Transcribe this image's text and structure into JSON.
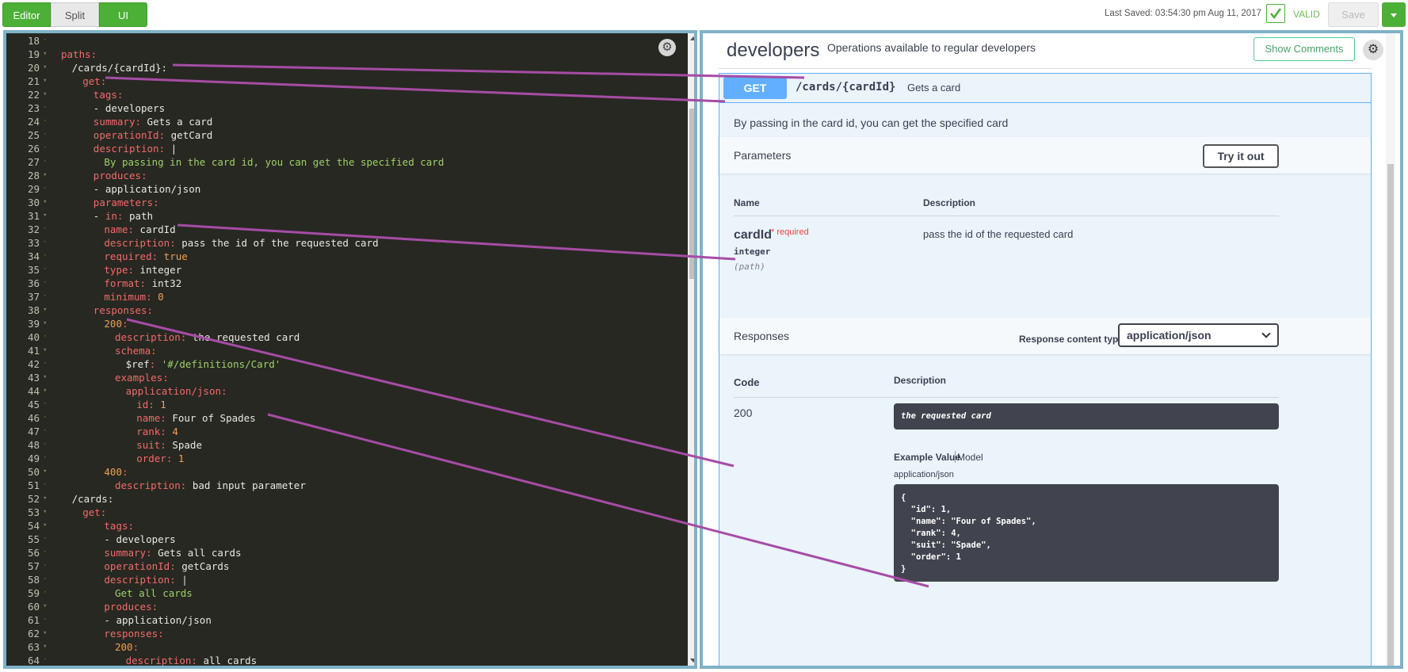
{
  "topbar": {
    "editor_label": "Editor",
    "split_label": "Split",
    "ui_label": "UI",
    "last_saved": "Last Saved: 03:54:30 pm Aug 11, 2017",
    "valid_label": "VALID",
    "save_label": "Save"
  },
  "editor": {
    "lines": [
      {
        "n": "18",
        "i": 0,
        "p": []
      },
      {
        "n": "19",
        "i": 0,
        "f": true,
        "p": [
          [
            "k",
            "paths"
          ],
          [
            "k",
            ":"
          ]
        ]
      },
      {
        "n": "20",
        "i": 1,
        "f": true,
        "p": [
          [
            "v",
            "/cards/{cardId}"
          ],
          [
            "v",
            ":"
          ]
        ]
      },
      {
        "n": "21",
        "i": 2,
        "f": true,
        "p": [
          [
            "k",
            "get"
          ],
          [
            "k",
            ":"
          ]
        ]
      },
      {
        "n": "22",
        "i": 3,
        "f": true,
        "p": [
          [
            "k",
            "tags"
          ],
          [
            "k",
            ":"
          ]
        ]
      },
      {
        "n": "23",
        "i": 3,
        "p": [
          [
            "v",
            "- developers"
          ]
        ]
      },
      {
        "n": "24",
        "i": 3,
        "p": [
          [
            "k",
            "summary"
          ],
          [
            "k",
            ":"
          ],
          [
            "v",
            " Gets a card"
          ]
        ]
      },
      {
        "n": "25",
        "i": 3,
        "p": [
          [
            "k",
            "operationId"
          ],
          [
            "k",
            ":"
          ],
          [
            "v",
            " getCard"
          ]
        ]
      },
      {
        "n": "26",
        "i": 3,
        "p": [
          [
            "k",
            "description"
          ],
          [
            "k",
            ":"
          ],
          [
            "v",
            " |"
          ]
        ]
      },
      {
        "n": "27",
        "i": 4,
        "p": [
          [
            "s",
            "By passing in the card id, you can get the specified card"
          ]
        ]
      },
      {
        "n": "28",
        "i": 3,
        "f": true,
        "p": [
          [
            "k",
            "produces"
          ],
          [
            "k",
            ":"
          ]
        ]
      },
      {
        "n": "29",
        "i": 3,
        "p": [
          [
            "v",
            "- application/json"
          ]
        ]
      },
      {
        "n": "30",
        "i": 3,
        "f": true,
        "p": [
          [
            "k",
            "parameters"
          ],
          [
            "k",
            ":"
          ]
        ]
      },
      {
        "n": "31",
        "i": 3,
        "f": true,
        "p": [
          [
            "v",
            "- "
          ],
          [
            "k",
            "in"
          ],
          [
            "k",
            ":"
          ],
          [
            "v",
            " path"
          ]
        ]
      },
      {
        "n": "32",
        "i": 4,
        "p": [
          [
            "k",
            "name"
          ],
          [
            "k",
            ":"
          ],
          [
            "v",
            " cardId"
          ]
        ]
      },
      {
        "n": "33",
        "i": 4,
        "p": [
          [
            "k",
            "description"
          ],
          [
            "k",
            ":"
          ],
          [
            "v",
            " pass the id of the requested card"
          ]
        ]
      },
      {
        "n": "34",
        "i": 4,
        "p": [
          [
            "k",
            "required"
          ],
          [
            "k",
            ":"
          ],
          [
            "n",
            " true"
          ]
        ]
      },
      {
        "n": "35",
        "i": 4,
        "p": [
          [
            "k",
            "type"
          ],
          [
            "k",
            ":"
          ],
          [
            "v",
            " integer"
          ]
        ]
      },
      {
        "n": "36",
        "i": 4,
        "p": [
          [
            "k",
            "format"
          ],
          [
            "k",
            ":"
          ],
          [
            "v",
            " int32"
          ]
        ]
      },
      {
        "n": "37",
        "i": 4,
        "p": [
          [
            "k",
            "minimum"
          ],
          [
            "k",
            ":"
          ],
          [
            "n",
            " 0"
          ]
        ]
      },
      {
        "n": "38",
        "i": 3,
        "f": true,
        "p": [
          [
            "k",
            "responses"
          ],
          [
            "k",
            ":"
          ]
        ]
      },
      {
        "n": "39",
        "i": 4,
        "f": true,
        "p": [
          [
            "n",
            "200"
          ],
          [
            "k",
            ":"
          ]
        ]
      },
      {
        "n": "40",
        "i": 5,
        "p": [
          [
            "k",
            "description"
          ],
          [
            "k",
            ":"
          ],
          [
            "v",
            " the requested card"
          ]
        ]
      },
      {
        "n": "41",
        "i": 5,
        "f": true,
        "p": [
          [
            "k",
            "schema"
          ],
          [
            "k",
            ":"
          ]
        ]
      },
      {
        "n": "42",
        "i": 6,
        "p": [
          [
            "v",
            "$ref"
          ],
          [
            "k",
            ":"
          ],
          [
            "s",
            " '#/definitions/Card'"
          ]
        ]
      },
      {
        "n": "43",
        "i": 5,
        "f": true,
        "p": [
          [
            "k",
            "examples"
          ],
          [
            "k",
            ":"
          ]
        ]
      },
      {
        "n": "44",
        "i": 6,
        "f": true,
        "p": [
          [
            "k",
            "application/json"
          ],
          [
            "k",
            ":"
          ]
        ]
      },
      {
        "n": "45",
        "i": 7,
        "p": [
          [
            "k",
            "id"
          ],
          [
            "k",
            ":"
          ],
          [
            "n",
            " 1"
          ]
        ]
      },
      {
        "n": "46",
        "i": 7,
        "p": [
          [
            "k",
            "name"
          ],
          [
            "k",
            ":"
          ],
          [
            "v",
            " Four of Spades"
          ]
        ]
      },
      {
        "n": "47",
        "i": 7,
        "p": [
          [
            "k",
            "rank"
          ],
          [
            "k",
            ":"
          ],
          [
            "n",
            " 4"
          ]
        ]
      },
      {
        "n": "48",
        "i": 7,
        "p": [
          [
            "k",
            "suit"
          ],
          [
            "k",
            ":"
          ],
          [
            "v",
            " Spade"
          ]
        ]
      },
      {
        "n": "49",
        "i": 7,
        "p": [
          [
            "k",
            "order"
          ],
          [
            "k",
            ":"
          ],
          [
            "n",
            " 1"
          ]
        ]
      },
      {
        "n": "50",
        "i": 4,
        "f": true,
        "p": [
          [
            "n",
            "400"
          ],
          [
            "k",
            ":"
          ]
        ]
      },
      {
        "n": "51",
        "i": 5,
        "p": [
          [
            "k",
            "description"
          ],
          [
            "k",
            ":"
          ],
          [
            "v",
            " bad input parameter"
          ]
        ]
      },
      {
        "n": "52",
        "i": 1,
        "f": true,
        "p": [
          [
            "v",
            "/cards"
          ],
          [
            "v",
            ":"
          ]
        ]
      },
      {
        "n": "53",
        "i": 2,
        "f": true,
        "p": [
          [
            "k",
            "get"
          ],
          [
            "k",
            ":"
          ]
        ]
      },
      {
        "n": "54",
        "i": 4,
        "f": true,
        "p": [
          [
            "k",
            "tags"
          ],
          [
            "k",
            ":"
          ]
        ]
      },
      {
        "n": "55",
        "i": 4,
        "p": [
          [
            "v",
            "- developers"
          ]
        ]
      },
      {
        "n": "56",
        "i": 4,
        "p": [
          [
            "k",
            "summary"
          ],
          [
            "k",
            ":"
          ],
          [
            "v",
            " Gets all cards"
          ]
        ]
      },
      {
        "n": "57",
        "i": 4,
        "p": [
          [
            "k",
            "operationId"
          ],
          [
            "k",
            ":"
          ],
          [
            "v",
            " getCards"
          ]
        ]
      },
      {
        "n": "58",
        "i": 4,
        "p": [
          [
            "k",
            "description"
          ],
          [
            "k",
            ":"
          ],
          [
            "v",
            " |"
          ]
        ]
      },
      {
        "n": "59",
        "i": 5,
        "p": [
          [
            "s",
            "Get all cards"
          ]
        ]
      },
      {
        "n": "60",
        "i": 4,
        "f": true,
        "p": [
          [
            "k",
            "produces"
          ],
          [
            "k",
            ":"
          ]
        ]
      },
      {
        "n": "61",
        "i": 4,
        "p": [
          [
            "v",
            "- application/json"
          ]
        ]
      },
      {
        "n": "62",
        "i": 4,
        "f": true,
        "p": [
          [
            "k",
            "responses"
          ],
          [
            "k",
            ":"
          ]
        ]
      },
      {
        "n": "63",
        "i": 5,
        "f": true,
        "p": [
          [
            "n",
            "200"
          ],
          [
            "k",
            ":"
          ]
        ]
      },
      {
        "n": "64",
        "i": 6,
        "p": [
          [
            "k",
            "description"
          ],
          [
            "k",
            ":"
          ],
          [
            "v",
            " all cards"
          ]
        ]
      }
    ]
  },
  "ui": {
    "tag_title": "developers",
    "tag_description": "Operations available to regular developers",
    "show_comments": "Show Comments",
    "method": "GET",
    "path": "/cards/{cardId}",
    "summary": "Gets a card",
    "description": "By passing in the card id, you can get the specified card",
    "parameters_title": "Parameters",
    "try_it_out": "Try it out",
    "params_col_name": "Name",
    "params_col_desc": "Description",
    "param": {
      "name": "cardId",
      "required": "* required",
      "type": "integer",
      "in": "(path)",
      "description": "pass the id of the requested card"
    },
    "responses_title": "Responses",
    "response_content_type_label": "Response content type",
    "response_content_type": "application/json",
    "resp_col_code": "Code",
    "resp_col_desc": "Description",
    "response": {
      "code": "200",
      "description": "the requested card",
      "example_value_tab": "Example Value",
      "model_tab": "Model",
      "mime": "application/json",
      "example_lines": [
        "{",
        "  \"id\": 1,",
        "  \"name\": \"Four of Spades\",",
        "  \"rank\": 4,",
        "  \"suit\": \"Spade\",",
        "  \"order\": 1",
        "}"
      ]
    }
  },
  "colors": {
    "brand_green": "#4caf36",
    "get_blue": "#61affe",
    "annotation_purple": "#a64ca6"
  }
}
